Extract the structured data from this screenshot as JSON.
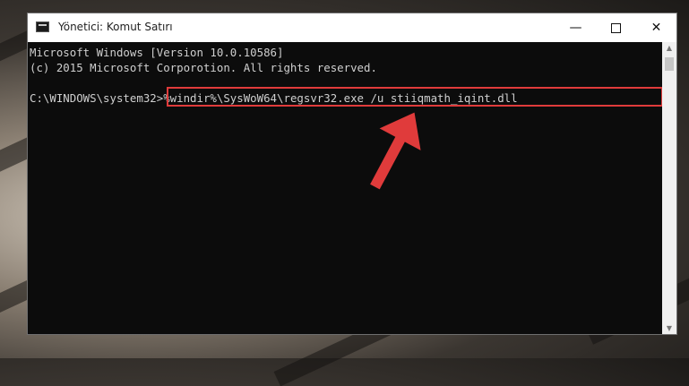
{
  "window": {
    "title": "Yönetici: Komut Satırı",
    "buttons": {
      "minimize": "—",
      "close": "✕"
    }
  },
  "console": {
    "line1": "Microsoft Windows [Version 10.0.10586]",
    "line2": "(c) 2015 Microsoft Corporotion. All rights reserved.",
    "prompt": "C:\\WINDOWS\\system32>",
    "command": "%windir%\\SysWoW64\\regsvr32.exe /u stiiqmath_iqint.dll"
  },
  "scrollbar": {
    "up": "▲",
    "down": "▼"
  },
  "colors": {
    "console_bg": "#0c0c0c",
    "console_text": "#cfcfcf",
    "highlight": "#e03b3b",
    "arrow": "#e03b3b"
  }
}
